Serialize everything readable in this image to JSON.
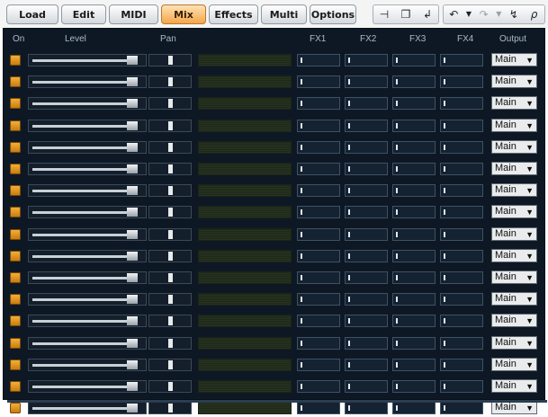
{
  "tabs": [
    {
      "label": "Load",
      "active": false
    },
    {
      "label": "Edit",
      "active": false
    },
    {
      "label": "MIDI",
      "active": false
    },
    {
      "label": "Mix",
      "active": true
    },
    {
      "label": "Effects",
      "active": false
    },
    {
      "label": "Multi",
      "active": false
    },
    {
      "label": "Options",
      "active": false
    }
  ],
  "toolbar": {
    "edit_icons": [
      "insert-icon",
      "copy-icon",
      "paste-icon"
    ],
    "history_icons": [
      "undo-icon",
      "undo-dropdown-icon",
      "redo-icon",
      "redo-dropdown-icon"
    ],
    "extra_icons": [
      "lightning-icon",
      "zoom-icon"
    ]
  },
  "headers": {
    "on": "On",
    "level": "Level",
    "pan": "Pan",
    "fx1": "FX1",
    "fx2": "FX2",
    "fx3": "FX3",
    "fx4": "FX4",
    "output": "Output"
  },
  "output_options": [
    "Main"
  ],
  "colors": {
    "accent": "#e8962a",
    "panel": "#0e1824",
    "fx_slot": "#142231"
  },
  "rows": [
    {
      "on": true,
      "level": 0.92,
      "pan": 0.5,
      "fx": [
        0,
        0,
        0,
        0
      ],
      "output": "Main"
    },
    {
      "on": true,
      "level": 0.92,
      "pan": 0.5,
      "fx": [
        0,
        0,
        0,
        0
      ],
      "output": "Main"
    },
    {
      "on": true,
      "level": 0.92,
      "pan": 0.5,
      "fx": [
        0,
        0,
        0,
        0
      ],
      "output": "Main"
    },
    {
      "on": true,
      "level": 0.92,
      "pan": 0.5,
      "fx": [
        0,
        0,
        0,
        0
      ],
      "output": "Main"
    },
    {
      "on": true,
      "level": 0.92,
      "pan": 0.5,
      "fx": [
        0,
        0,
        0,
        0
      ],
      "output": "Main"
    },
    {
      "on": true,
      "level": 0.92,
      "pan": 0.5,
      "fx": [
        0,
        0,
        0,
        0
      ],
      "output": "Main"
    },
    {
      "on": true,
      "level": 0.92,
      "pan": 0.5,
      "fx": [
        0,
        0,
        0,
        0
      ],
      "output": "Main"
    },
    {
      "on": true,
      "level": 0.92,
      "pan": 0.5,
      "fx": [
        0,
        0,
        0,
        0
      ],
      "output": "Main"
    },
    {
      "on": true,
      "level": 0.92,
      "pan": 0.5,
      "fx": [
        0,
        0,
        0,
        0
      ],
      "output": "Main"
    },
    {
      "on": true,
      "level": 0.92,
      "pan": 0.5,
      "fx": [
        0,
        0,
        0,
        0
      ],
      "output": "Main"
    },
    {
      "on": true,
      "level": 0.92,
      "pan": 0.5,
      "fx": [
        0,
        0,
        0,
        0
      ],
      "output": "Main"
    },
    {
      "on": true,
      "level": 0.92,
      "pan": 0.5,
      "fx": [
        0,
        0,
        0,
        0
      ],
      "output": "Main"
    },
    {
      "on": true,
      "level": 0.92,
      "pan": 0.5,
      "fx": [
        0,
        0,
        0,
        0
      ],
      "output": "Main"
    },
    {
      "on": true,
      "level": 0.92,
      "pan": 0.5,
      "fx": [
        0,
        0,
        0,
        0
      ],
      "output": "Main"
    },
    {
      "on": true,
      "level": 0.92,
      "pan": 0.5,
      "fx": [
        0,
        0,
        0,
        0
      ],
      "output": "Main"
    },
    {
      "on": true,
      "level": 0.92,
      "pan": 0.5,
      "fx": [
        0,
        0,
        0,
        0
      ],
      "output": "Main"
    },
    {
      "on": true,
      "level": 0.92,
      "pan": 0.5,
      "fx": [
        0,
        0,
        0,
        0
      ],
      "output": "Main"
    }
  ]
}
